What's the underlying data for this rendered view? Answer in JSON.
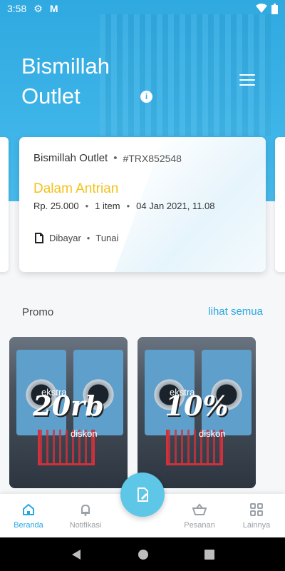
{
  "status_bar": {
    "time": "3:58",
    "battery_icon": "battery-icon",
    "wifi_icon": "wifi-icon"
  },
  "header": {
    "title_line1": "Bismillah",
    "title_line2": "Outlet",
    "info_icon": "info-icon",
    "menu_icon": "menu-icon"
  },
  "transaction_card": {
    "outlet": "Bismillah Outlet",
    "trx_id": "#TRX852548",
    "status": "Dalam Antrian",
    "price": "Rp. 25.000",
    "items": "1 item",
    "date": "04 Jan 2021, 11.08",
    "payment_state": "Dibayar",
    "payment_method": "Tunai"
  },
  "promo": {
    "label": "Promo",
    "link": "lihat semua",
    "cards": [
      {
        "top_text": "ekstra",
        "big_text": "20rb",
        "bottom_text": "diskon"
      },
      {
        "top_text": "ekstra",
        "big_text": "10%",
        "bottom_text": "diskon"
      }
    ]
  },
  "bottom_nav": {
    "items": [
      {
        "label": "Beranda",
        "icon": "home-icon"
      },
      {
        "label": "Notifikasi",
        "icon": "bell-icon"
      },
      {
        "label": "Pesanan",
        "icon": "basket-icon"
      },
      {
        "label": "Lainnya",
        "icon": "grid-icon"
      }
    ],
    "fab_icon": "new-order-icon"
  },
  "colors": {
    "primary": "#29a8df",
    "status_yellow": "#f2c21b"
  }
}
